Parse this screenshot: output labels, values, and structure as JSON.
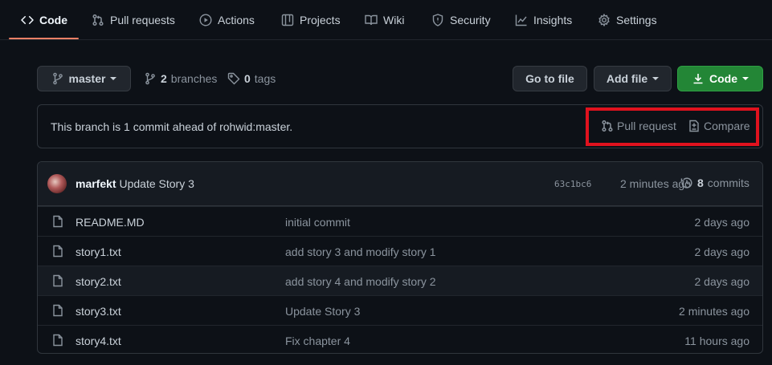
{
  "nav": {
    "tabs": [
      {
        "label": "Code",
        "icon": "code-icon",
        "active": true
      },
      {
        "label": "Pull requests",
        "icon": "git-pull-request-icon"
      },
      {
        "label": "Actions",
        "icon": "play-circle-icon"
      },
      {
        "label": "Projects",
        "icon": "table-icon"
      },
      {
        "label": "Wiki",
        "icon": "book-icon"
      },
      {
        "label": "Security",
        "icon": "shield-icon"
      },
      {
        "label": "Insights",
        "icon": "graph-icon"
      },
      {
        "label": "Settings",
        "icon": "gear-icon"
      }
    ],
    "accent_color": "#f78166"
  },
  "toolbar": {
    "branch": "master",
    "branches_count": "2",
    "branches_label": "branches",
    "tags_count": "0",
    "tags_label": "tags",
    "go_to_file": "Go to file",
    "add_file": "Add file",
    "code": "Code",
    "code_button_color": "#238636"
  },
  "ahead": {
    "message": "This branch is 1 commit ahead of rohwid:master.",
    "pull_request": "Pull request",
    "compare": "Compare",
    "highlight_color": "#e0121e"
  },
  "latest_commit": {
    "author": "marfekt",
    "message": "Update Story 3",
    "hash": "63c1bc6",
    "time": "2 minutes ago",
    "commits_count": "8",
    "commits_label": "commits"
  },
  "files": [
    {
      "name": "README.MD",
      "message": "initial commit",
      "age": "2 days ago"
    },
    {
      "name": "story1.txt",
      "message": "add story 3 and modify story 1",
      "age": "2 days ago"
    },
    {
      "name": "story2.txt",
      "message": "add story 4 and modify story 2",
      "age": "2 days ago"
    },
    {
      "name": "story3.txt",
      "message": "Update Story 3",
      "age": "2 minutes ago"
    },
    {
      "name": "story4.txt",
      "message": "Fix chapter 4",
      "age": "11 hours ago"
    }
  ]
}
